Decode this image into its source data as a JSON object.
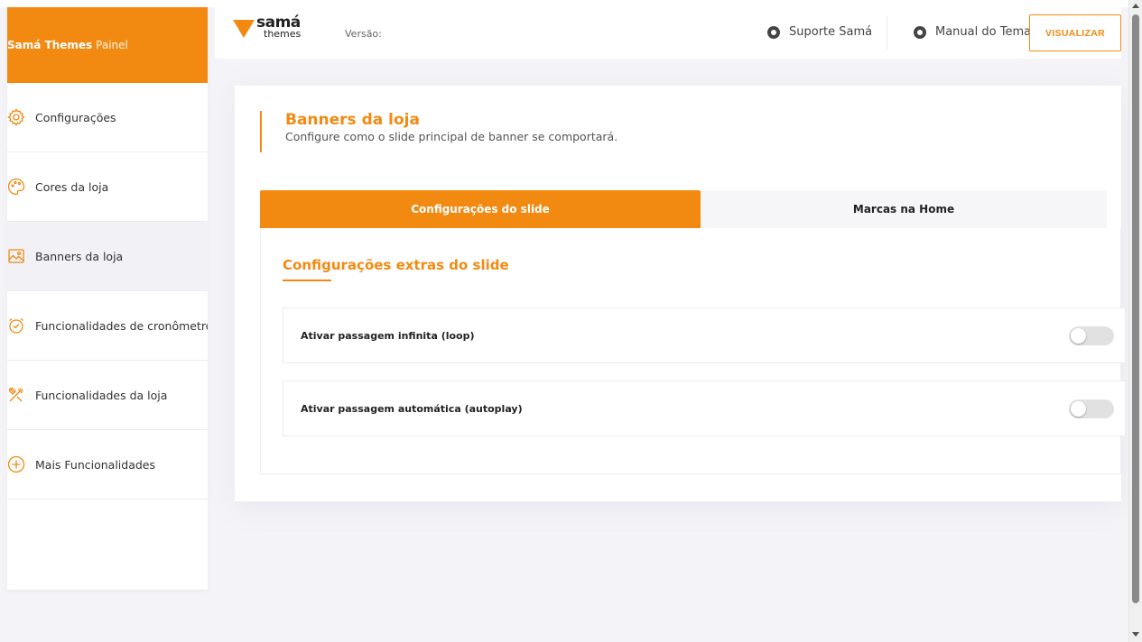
{
  "sidebar": {
    "brand_bold": "Samá Themes",
    "brand_light": "Painel",
    "items": [
      {
        "label": "Configurações",
        "icon": "gear-icon"
      },
      {
        "label": "Cores da loja",
        "icon": "palette-icon"
      },
      {
        "label": "Banners da loja",
        "icon": "image-icon",
        "active": true
      },
      {
        "label": "Funcionalidades de cronômetros",
        "icon": "alarm-clock-icon"
      },
      {
        "label": "Funcionalidades da loja",
        "icon": "tools-icon"
      },
      {
        "label": "Mais Funcionalidades",
        "icon": "plus-circle-icon"
      }
    ]
  },
  "header": {
    "logo_line1": "samá",
    "logo_line2": "themes",
    "versao_label": "Versão:",
    "suporte_label": "Suporte Samá",
    "manual_label": "Manual do Tema",
    "visualizar_label": "VISUALIZAR"
  },
  "main": {
    "title": "Banners da loja",
    "subtitle": "Configure como o slide principal de banner se comportará.",
    "tabs": [
      {
        "label": "Configurações do slide",
        "active": true
      },
      {
        "label": "Marcas na Home",
        "active": false
      }
    ],
    "section_title": "Configurações extras do slide",
    "options": [
      {
        "label": "Ativar passagem infinita (loop)",
        "enabled": false
      },
      {
        "label": "Ativar passagem automática (autoplay)",
        "enabled": false
      }
    ]
  },
  "colors": {
    "accent": "#f28a12",
    "background": "#f4f4f8",
    "toggle_off": "#e1e1e1"
  }
}
